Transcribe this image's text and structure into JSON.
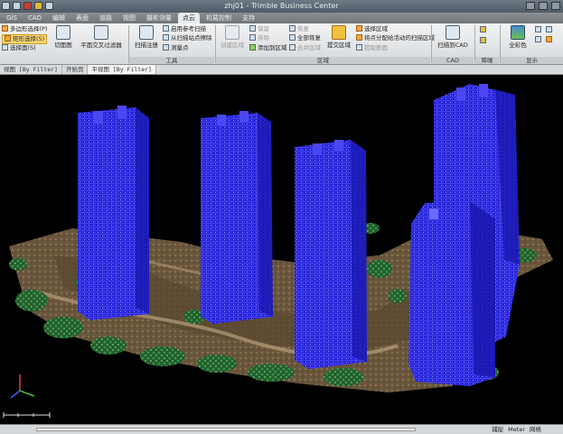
{
  "app": {
    "title": "zhj01 - Trimble Business Center"
  },
  "tabs": [
    {
      "label": "GIS"
    },
    {
      "label": "CAD"
    },
    {
      "label": "编辑"
    },
    {
      "label": "表面"
    },
    {
      "label": "道路"
    },
    {
      "label": "视图"
    },
    {
      "label": "摄影测量"
    },
    {
      "label": "点云"
    },
    {
      "label": "机载控制"
    },
    {
      "label": "支持"
    }
  ],
  "active_tab_index": 7,
  "ribbon": {
    "select_items": [
      {
        "label": "多边形选择(P)"
      },
      {
        "label": "矩形选择(S)"
      },
      {
        "label": "选择面(S)"
      }
    ],
    "big_buttons": [
      {
        "label": "切面图"
      },
      {
        "label": "平面交叉过滤器"
      },
      {
        "label": "扫描注册"
      }
    ],
    "tools_items": [
      {
        "label": "启用参考扫描"
      },
      {
        "label": "从扫描站点擦除"
      },
      {
        "label": "测量点"
      }
    ],
    "region_items": [
      {
        "label": "创建区域"
      },
      {
        "label": "保留"
      },
      {
        "label": "排除"
      },
      {
        "label": "添加到区域"
      },
      {
        "label": "恢复"
      },
      {
        "label": "全部恢复"
      },
      {
        "label": "合并区域"
      },
      {
        "label": "提交区域"
      },
      {
        "label": "选择区域"
      },
      {
        "label": "将点分配给活动的扫描区域"
      },
      {
        "label": "提取断面"
      }
    ],
    "cad_button": {
      "label": "扫描到CAD"
    },
    "color_button": {
      "label": "全彩色"
    },
    "group_labels": [
      {
        "label": "工具"
      },
      {
        "label": "区域"
      },
      {
        "label": "CAD"
      },
      {
        "label": "降噪"
      },
      {
        "label": "显示"
      }
    ]
  },
  "view_tabs": [
    {
      "label": "视图 [By Filter]"
    },
    {
      "label": "开始页"
    },
    {
      "label": "平视图 [By Filter]"
    }
  ],
  "statusbar": {
    "left": "",
    "progress": 0,
    "right": [
      {
        "label": "捕捉"
      },
      {
        "label": "Meter"
      },
      {
        "label": "网格"
      }
    ]
  },
  "colors": {
    "building": "#2a28e8",
    "building_highlight": "#8d8cff",
    "terrain": "#8a7150",
    "vegetation": "#2f7a3a",
    "background": "#000000"
  }
}
